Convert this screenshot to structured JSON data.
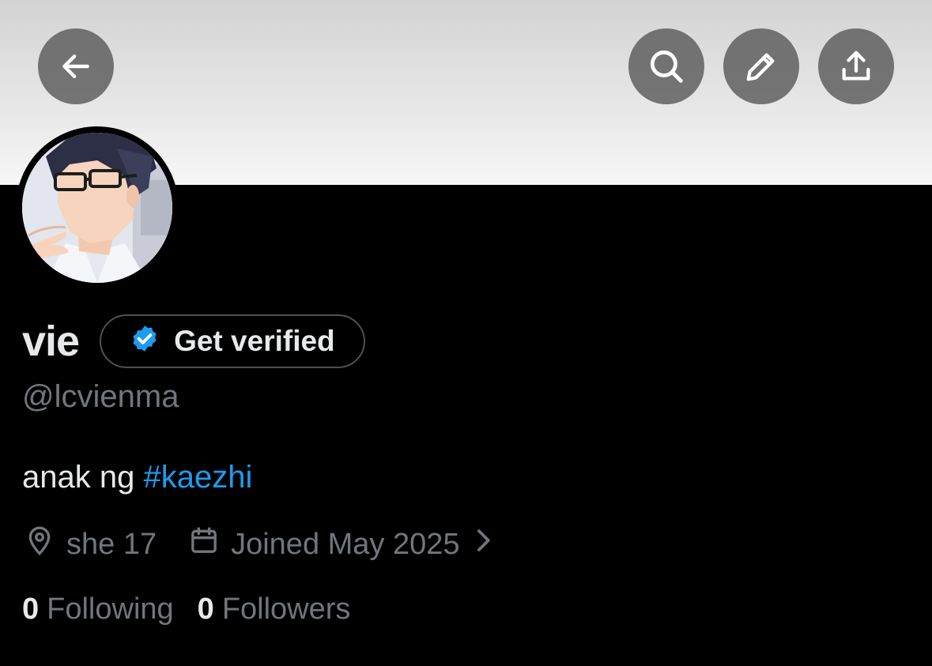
{
  "profile": {
    "display_name": "vie",
    "handle": "@lcvienma",
    "bio_text": "anak ng ",
    "bio_hashtag": "#kaezhi",
    "location": "she 17",
    "joined": "Joined May 2025",
    "following_count": "0",
    "following_label": "Following",
    "followers_count": "0",
    "followers_label": "Followers"
  },
  "verify": {
    "label": "Get verified"
  },
  "icons": {
    "back": "arrow-left-icon",
    "search": "search-icon",
    "edit": "pencil-icon",
    "share": "share-upload-icon",
    "location": "location-pin-icon",
    "calendar": "calendar-icon",
    "chevron": "chevron-right-icon",
    "badge": "verified-badge-icon"
  },
  "colors": {
    "background": "#000000",
    "accent": "#1d9bf0",
    "text_primary": "#e7e9ea",
    "text_secondary": "#71767b"
  }
}
